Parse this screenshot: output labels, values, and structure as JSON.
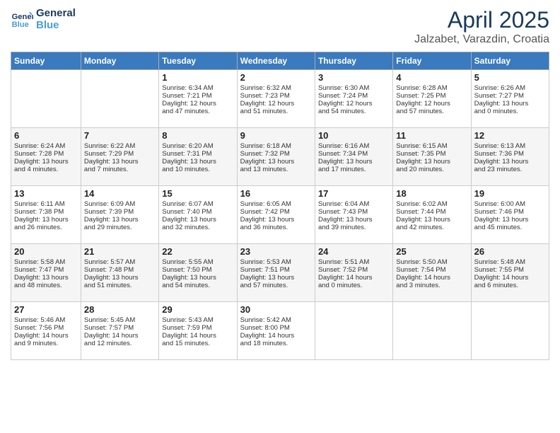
{
  "header": {
    "logo_line1": "General",
    "logo_line2": "Blue",
    "month_title": "April 2025",
    "location": "Jalzabet, Varazdin, Croatia"
  },
  "days_of_week": [
    "Sunday",
    "Monday",
    "Tuesday",
    "Wednesday",
    "Thursday",
    "Friday",
    "Saturday"
  ],
  "weeks": [
    [
      {
        "day": "",
        "info": ""
      },
      {
        "day": "",
        "info": ""
      },
      {
        "day": "1",
        "info": "Sunrise: 6:34 AM\nSunset: 7:21 PM\nDaylight: 12 hours\nand 47 minutes."
      },
      {
        "day": "2",
        "info": "Sunrise: 6:32 AM\nSunset: 7:23 PM\nDaylight: 12 hours\nand 51 minutes."
      },
      {
        "day": "3",
        "info": "Sunrise: 6:30 AM\nSunset: 7:24 PM\nDaylight: 12 hours\nand 54 minutes."
      },
      {
        "day": "4",
        "info": "Sunrise: 6:28 AM\nSunset: 7:25 PM\nDaylight: 12 hours\nand 57 minutes."
      },
      {
        "day": "5",
        "info": "Sunrise: 6:26 AM\nSunset: 7:27 PM\nDaylight: 13 hours\nand 0 minutes."
      }
    ],
    [
      {
        "day": "6",
        "info": "Sunrise: 6:24 AM\nSunset: 7:28 PM\nDaylight: 13 hours\nand 4 minutes."
      },
      {
        "day": "7",
        "info": "Sunrise: 6:22 AM\nSunset: 7:29 PM\nDaylight: 13 hours\nand 7 minutes."
      },
      {
        "day": "8",
        "info": "Sunrise: 6:20 AM\nSunset: 7:31 PM\nDaylight: 13 hours\nand 10 minutes."
      },
      {
        "day": "9",
        "info": "Sunrise: 6:18 AM\nSunset: 7:32 PM\nDaylight: 13 hours\nand 13 minutes."
      },
      {
        "day": "10",
        "info": "Sunrise: 6:16 AM\nSunset: 7:34 PM\nDaylight: 13 hours\nand 17 minutes."
      },
      {
        "day": "11",
        "info": "Sunrise: 6:15 AM\nSunset: 7:35 PM\nDaylight: 13 hours\nand 20 minutes."
      },
      {
        "day": "12",
        "info": "Sunrise: 6:13 AM\nSunset: 7:36 PM\nDaylight: 13 hours\nand 23 minutes."
      }
    ],
    [
      {
        "day": "13",
        "info": "Sunrise: 6:11 AM\nSunset: 7:38 PM\nDaylight: 13 hours\nand 26 minutes."
      },
      {
        "day": "14",
        "info": "Sunrise: 6:09 AM\nSunset: 7:39 PM\nDaylight: 13 hours\nand 29 minutes."
      },
      {
        "day": "15",
        "info": "Sunrise: 6:07 AM\nSunset: 7:40 PM\nDaylight: 13 hours\nand 32 minutes."
      },
      {
        "day": "16",
        "info": "Sunrise: 6:05 AM\nSunset: 7:42 PM\nDaylight: 13 hours\nand 36 minutes."
      },
      {
        "day": "17",
        "info": "Sunrise: 6:04 AM\nSunset: 7:43 PM\nDaylight: 13 hours\nand 39 minutes."
      },
      {
        "day": "18",
        "info": "Sunrise: 6:02 AM\nSunset: 7:44 PM\nDaylight: 13 hours\nand 42 minutes."
      },
      {
        "day": "19",
        "info": "Sunrise: 6:00 AM\nSunset: 7:46 PM\nDaylight: 13 hours\nand 45 minutes."
      }
    ],
    [
      {
        "day": "20",
        "info": "Sunrise: 5:58 AM\nSunset: 7:47 PM\nDaylight: 13 hours\nand 48 minutes."
      },
      {
        "day": "21",
        "info": "Sunrise: 5:57 AM\nSunset: 7:48 PM\nDaylight: 13 hours\nand 51 minutes."
      },
      {
        "day": "22",
        "info": "Sunrise: 5:55 AM\nSunset: 7:50 PM\nDaylight: 13 hours\nand 54 minutes."
      },
      {
        "day": "23",
        "info": "Sunrise: 5:53 AM\nSunset: 7:51 PM\nDaylight: 13 hours\nand 57 minutes."
      },
      {
        "day": "24",
        "info": "Sunrise: 5:51 AM\nSunset: 7:52 PM\nDaylight: 14 hours\nand 0 minutes."
      },
      {
        "day": "25",
        "info": "Sunrise: 5:50 AM\nSunset: 7:54 PM\nDaylight: 14 hours\nand 3 minutes."
      },
      {
        "day": "26",
        "info": "Sunrise: 5:48 AM\nSunset: 7:55 PM\nDaylight: 14 hours\nand 6 minutes."
      }
    ],
    [
      {
        "day": "27",
        "info": "Sunrise: 5:46 AM\nSunset: 7:56 PM\nDaylight: 14 hours\nand 9 minutes."
      },
      {
        "day": "28",
        "info": "Sunrise: 5:45 AM\nSunset: 7:57 PM\nDaylight: 14 hours\nand 12 minutes."
      },
      {
        "day": "29",
        "info": "Sunrise: 5:43 AM\nSunset: 7:59 PM\nDaylight: 14 hours\nand 15 minutes."
      },
      {
        "day": "30",
        "info": "Sunrise: 5:42 AM\nSunset: 8:00 PM\nDaylight: 14 hours\nand 18 minutes."
      },
      {
        "day": "",
        "info": ""
      },
      {
        "day": "",
        "info": ""
      },
      {
        "day": "",
        "info": ""
      }
    ]
  ]
}
